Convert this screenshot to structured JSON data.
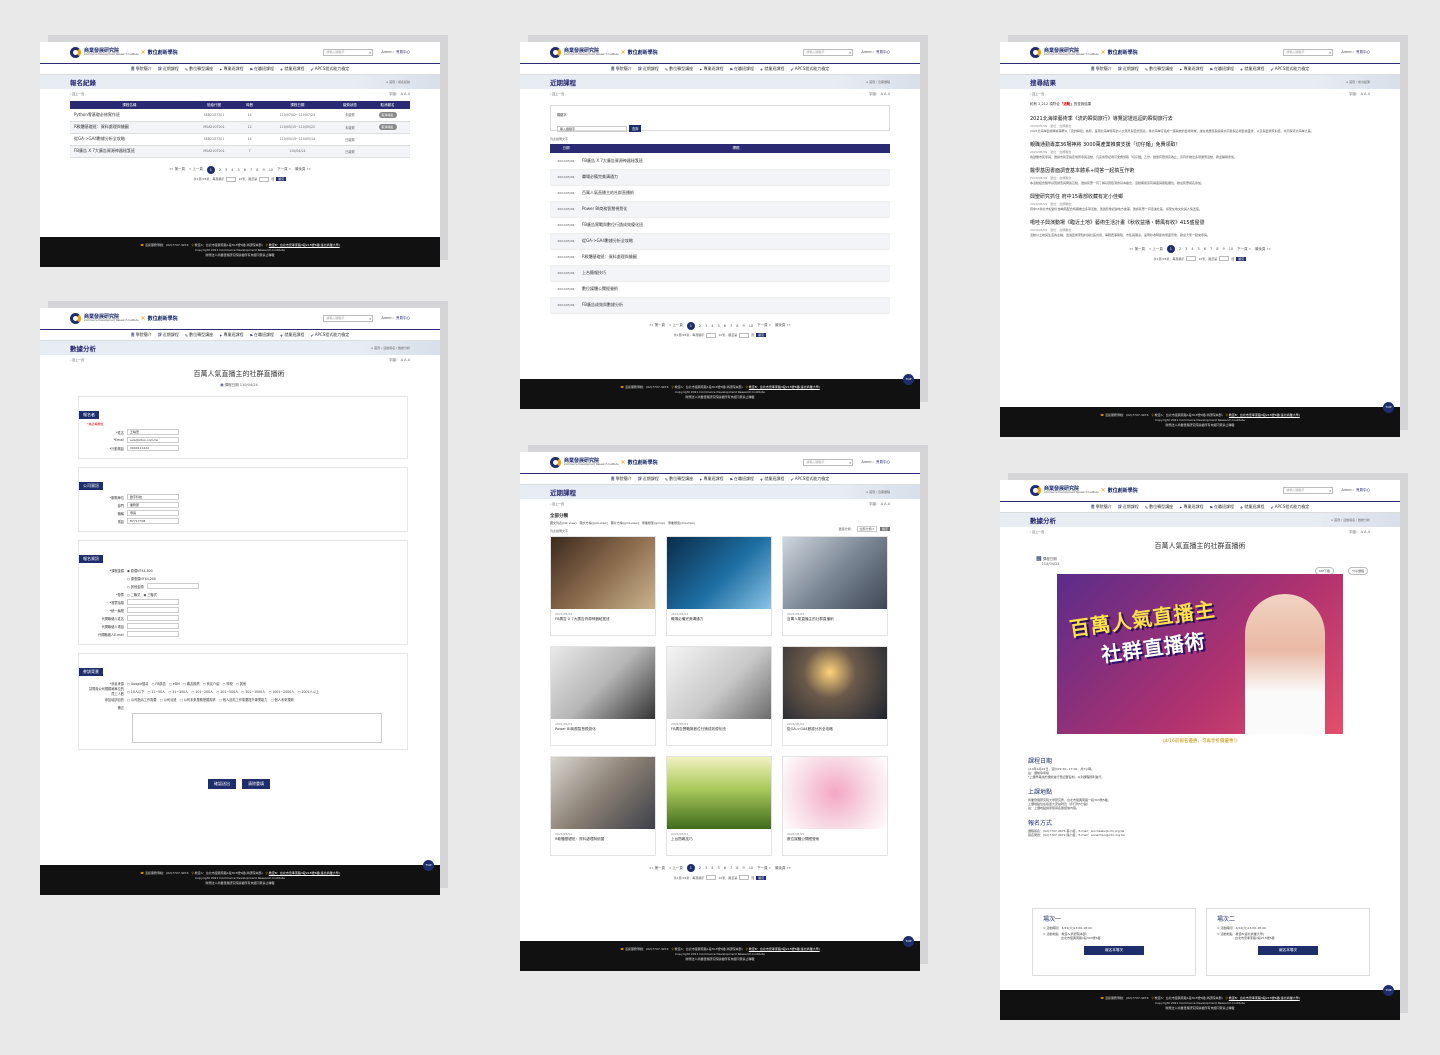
{
  "common": {
    "org_name": "商業發展研究院",
    "org_en": "Commerce Development Research Institute",
    "academy": "數位創新學院",
    "search_placeholder": "請輸入關鍵字",
    "user_prefix": "Admin",
    "user_link": "會員中心",
    "nav": [
      {
        "icon": "書",
        "label": "學院簡介"
      },
      {
        "icon": "課",
        "label": "近期課程"
      },
      {
        "icon": "✎",
        "label": "數位轉型講座"
      },
      {
        "icon": "✦",
        "label": "專業班課程"
      },
      {
        "icon": "⚑",
        "label": "在職班課程"
      },
      {
        "icon": "✈",
        "label": "就業班課程"
      },
      {
        "icon": "✔",
        "label": "APCS程式能力檢定"
      }
    ],
    "back": "回上一頁",
    "fontsize": "字級： A A A",
    "footer_phone": "活訊服務專線：(02)7707-4974",
    "footer_addr": "教室A：台北市復興南路1段303號5樓(商研院本部)",
    "footer_link": "教室B：台北市忠孝東路3段215號5樓(臺北商業大學)",
    "copyright": "Copyright 2021 Commerce Development Research Institute",
    "rights": "財團法人商業發展研究院版權所有未經同意禁止轉載",
    "top": "TOP",
    "pager_prev": [
      "第一頁",
      "上一頁"
    ],
    "pager_pages": [
      "1",
      "2",
      "3",
      "4",
      "5",
      "6",
      "7",
      "8",
      "9",
      "10"
    ],
    "pager_next": [
      "下一頁",
      "最後頁"
    ],
    "pager_info": "共1頁/26筆，每頁顯示",
    "pager_per": "10筆，跳至第",
    "pager_go": "頁",
    "pager_btn": "確定"
  },
  "p1": {
    "title": "報名紀錄",
    "breadcrumb": "首頁 / 報名紀錄",
    "headers": [
      "課程名稱",
      "班級代號",
      "時數",
      "課程日期",
      "繳費狀態",
      "取消報名"
    ],
    "rows": [
      {
        "name": "Python零基礎必修實作班",
        "code": "SEB2107201",
        "hours": "14",
        "date": "110/07/02~110/07/23",
        "status": "未繳費",
        "btn": "取消報名"
      },
      {
        "name": "R軟體基礎班：資料處理與繪圖",
        "code": "MSA2107201",
        "hours": "12",
        "date": "110/05/15~110/05/22",
        "status": "未繳費",
        "btn": "取消報名"
      },
      {
        "name": "從GA->GA4數據分析全攻略",
        "code": "SEB2107201",
        "hours": "14",
        "date": "110/05/15~110/05/14",
        "status": "已繳費",
        "btn": ""
      },
      {
        "name": "FB廣告 X 7大廣告資源神器秘笈班",
        "code": "MSA2107201",
        "hours": "7",
        "date": "110/04/24",
        "status": "已繳費",
        "btn": ""
      }
    ]
  },
  "p2": {
    "title": "數據分析",
    "breadcrumb": "首頁 / 活動報名 / 數據分析",
    "course": "百萬人氣直播主的社群直播術",
    "date_label": "課程日期",
    "date": "110/04/24",
    "sec1": "報名者",
    "req": "*為必填欄位",
    "f_name": "*姓名",
    "v_name": "王曉華",
    "f_mail": "*Email",
    "v_mail": "eva@kitun.com.tw",
    "f_tel": "*行動電話",
    "v_tel": "0900111222",
    "sec2": "公司資訊",
    "f_comp": "*服務單位",
    "v_comp": "數字科技",
    "f_dept": "部門",
    "v_dept": "業務部",
    "f_title": "職稱",
    "v_title": "專員",
    "f_phone": "電話",
    "v_phone": "87717708",
    "sec3": "報名資訊",
    "f_fee": "*課程金額",
    "fee1": "◉ 原價NT$4,800",
    "fee2": "○ 優惠價NT$4,200",
    "fee3": "○ 其他金額",
    "f_inv": "*發票",
    "inv": "○ 二聯式　◉ 三聯式",
    "f_invtitle": "*發票抬頭",
    "f_tax": "*統一編號",
    "f_cname": "代開聯絡人姓名",
    "f_ctel": "代開聯絡人電話",
    "f_cmail": "代開聯絡人E-mail",
    "sec4": "參訓背景",
    "f_src": "*消息來源",
    "src": "○ Google搜尋　○ FB廣告　○ eDM　○ 親友推薦　○ 商友介紹　○ 學校　○ 其他",
    "f_size": "請問貴公司規模屬單位的員工人數",
    "size": "○ 10人以下　○ 11~50人　○ 51~100人　○ 101~200人　○ 201~500人　○ 501~1000人　○ 1001~2000人　○ 2001人以上",
    "f_reason": "參加培訓目的",
    "reason": "□ 公司指派工作需要　□ 公司派遣　□ 公司未來業務發展需求　□ 個人目前工作需要提升專業能力　□ 個人未來規劃",
    "f_note": "備註",
    "btn_ok": "確認送出",
    "btn_clear": "清除重填"
  },
  "p3": {
    "title": "近期課程",
    "breadcrumb": "首頁 / 近期課程",
    "search_label": "關鍵字",
    "search_ph": "輸入關鍵字",
    "search_btn": "查詢",
    "note": "列表說明文字",
    "headers": [
      "日期",
      "標題"
    ],
    "rows": [
      {
        "d": "2021/05/01",
        "t": "FB廣告 X 7大廣告資源神器秘笈班"
      },
      {
        "d": "2021/05/01",
        "t": "職場必備完美溝通力"
      },
      {
        "d": "2021/05/01",
        "t": "百萬人氣直播主的社群直播術"
      },
      {
        "d": "2021/05/01",
        "t": "Power BI商務智慧視覺化"
      },
      {
        "d": "2021/05/01",
        "t": "FB廣告實戰與數位行銷成效優化班"
      },
      {
        "d": "2021/05/01",
        "t": "從GA->GA4數據分析全攻略"
      },
      {
        "d": "2021/05/01",
        "t": "R軟體基礎班：資料處理與繪圖"
      },
      {
        "d": "2021/05/01",
        "t": "上台簡報技巧"
      },
      {
        "d": "2021/05/01",
        "t": "數位媒體公關經營術"
      },
      {
        "d": "2021/05/01",
        "t": "FB廣告成效與數據分析"
      }
    ]
  },
  "p4": {
    "title": "近期課程",
    "breadcrumb": "首頁 / 近期課程",
    "sort_label": "選擇分類：",
    "sort_value": "全部分類",
    "sort_btn": "確定",
    "cat": "全部分類",
    "catinfo": "圖文列表(list-view)　圖文方塊(grid-view)　圖片方塊(grid-view)　專業類型(group)　專業類型(direction)",
    "note": "列表說明文字",
    "cards": [
      {
        "d": "2021/05/01",
        "t": "FB廣告 X 7大廣告資源神器秘笈班",
        "bg": "linear-gradient(135deg,#3b2a1e,#8a6a4c 50%,#c9b48e)"
      },
      {
        "d": "2021/05/01",
        "t": "職場必備完美溝通力",
        "bg": "linear-gradient(135deg,#0b2c49,#1d6ea3 55%,#8cc4e6)"
      },
      {
        "d": "2021/05/01",
        "t": "百萬人氣直播主的社群直播術",
        "bg": "linear-gradient(135deg,#cfd6de,#7c8896 50%,#3d4654)"
      },
      {
        "d": "2021/05/01",
        "t": "Power BI商務智慧視覺化",
        "bg": "linear-gradient(135deg,#e9e9e9,#b7b7b7 50%,#333)"
      },
      {
        "d": "2021/05/01",
        "t": "FB廣告實戰與數位行銷成效優化班",
        "bg": "linear-gradient(135deg,#f5f5f5,#c8c8c8 55%,#6b6b6b)"
      },
      {
        "d": "2021/05/01",
        "t": "從GA->GA4數據分析全攻略",
        "bg": "radial-gradient(circle at 45% 35%,#ffd27a,#6b5a4a 35%,#1e2430)"
      },
      {
        "d": "2021/05/01",
        "t": "R軟體基礎班：資料處理與繪圖",
        "bg": "linear-gradient(135deg,#d8d5cf,#8a7f73 50%,#3c3f4a)"
      },
      {
        "d": "2021/05/01",
        "t": "上台簡報技巧",
        "bg": "linear-gradient(180deg,#f2f2c0,#a8c85a 45%,#3f6b1c)"
      },
      {
        "d": "2021/05/01",
        "t": "數位媒體公關經營術",
        "bg": "radial-gradient(circle at 50% 50%,#f4a6c4,#f7d6e2 50%,#fff)"
      }
    ]
  },
  "p5": {
    "title": "搜尋結果",
    "breadcrumb": "首頁 / 搜尋結果",
    "summary_pre": "約有 2,212 項符合",
    "summary_kw": "「活動」",
    "summary_post": "的查詢結果",
    "meta": "2020/05/09　單位：台師聯合",
    "results": [
      {
        "t": "2021北海岸藝術季《流的瞬間旅行》導覽認證巡迴的瞬間旅行去",
        "d": "2021北海岸藝術季將藉著以『流的瞬間』為題，呈現北海岸特有的人文風景與自然環境，將北海岸打造成一座開放的藝術場域，讓在地居民與遊客共同參與這場藝術盛會，以及與藝術家對話，共同探索北海岸之美。"
      },
      {
        "t": "親職通勤專案36場神將 3000萬產業推廣支援「切仔麵」免費領取！",
        "d": "為鼓勵市民參與，邀請市民至指定場所參與活動，凡完成登記者可免費領取「切仔麵」乙份，數量有限領完為止，另同步推出多項優惠活動，歡迎踴躍參加。"
      },
      {
        "t": "醫學基因書面調查基本體系+問答一起搞互作術",
        "d": "本活動結合醫學基因調查與問答互動，邀請民眾一同了解基因檢測的基本觀念，活動期間另有講座與體驗攤位，歡迎民眾報名參加。"
      },
      {
        "t": "興聖研究抓住 府中15專部收藏有定小佳鄉",
        "d": "府中15新北市紀錄片放映院配合特展推出多項活動，透過影像記錄地方故事，邀請民眾一同走進社區，感受在地文化與人情溫度。"
      },
      {
        "t": "噶哇子興演動場《臨近土地》藝術生活計畫《秋收益播・轉風有收》415盛屋發",
        "d": "活動以土地與生活為主軸，透過藝術家駐村與社區共創，串聯農事體驗、市集與展演，呈現秋收時節的豐盛景象，歡迎大家一起來參與。"
      }
    ]
  },
  "p6": {
    "title": "數據分析",
    "breadcrumb": "首頁 / 活動報名 / 數據分析",
    "course": "百萬人氣直播主的社群直播術",
    "date_label": "課程日期",
    "date": "110/04/24",
    "btn_dm": "DM下載",
    "btn_share": "分享課程",
    "poster_1": "百萬人氣直播主",
    "poster_2": "社群直播術",
    "tag": "《4/16前報名優惠，可再享折價優惠!》",
    "s1_h": "課程日期",
    "s1_p": "110年4月24日，週六09:30~17:00，共7小時。\n註：課前停車場\n*上課學員請於課前進行登記實名制，以利課程順利進行。",
    "s2_h": "上課地點",
    "s2_p": "商業發展研究院大學研究所，台北市復興南路一段303號5樓。\n上課地點位在捷運大安站附近（步行約5分鐘）\n註：上課地點請參照報名確認信內容。",
    "s3_h": "報名方式",
    "s3_p": "課程報名：(02)7707-4975 蔡小姐，E-mail：sinchealu@cdri.org.tw\n報名問題：(02)7707-4972 陳小姐，E-mail：annechen@cdri.org.tw",
    "sess": [
      {
        "h": "場次一",
        "t": "⊙ 活動時間　4/24(六)13:00-18:00",
        "l": "⊙ 活動地點　教室A(商研院本部)\n　　　　　　台北市復興南路1段303號5樓",
        "b": "報名本場次"
      },
      {
        "h": "場次二",
        "t": "⊙ 活動時間　4/24(六)13:00-18:00",
        "l": "⊙ 活動地點　教室B(臺北商業大學)\n　　　　　　台北市忠孝東路3段215號5樓",
        "b": "報名本場次"
      }
    ]
  }
}
